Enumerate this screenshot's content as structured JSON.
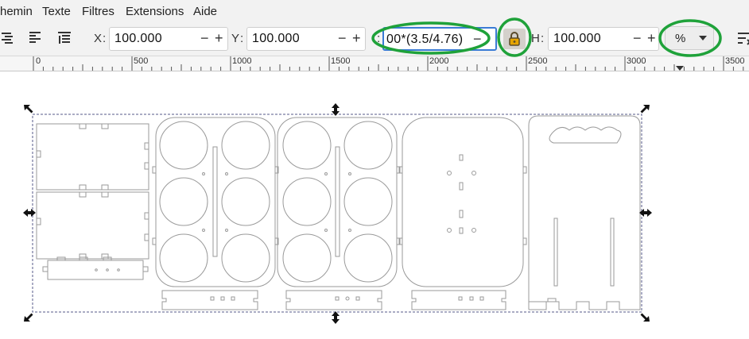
{
  "menu": {
    "items": [
      "hemin",
      "Texte",
      "Filtres",
      "Extensions",
      "Aide"
    ]
  },
  "toolbar": {
    "x_label": "X",
    "x_value": "100.000",
    "y_label": "Y",
    "y_value": "100.000",
    "w_value": "00*(3.5/4.76)",
    "h_label": "H",
    "h_value": "100.000",
    "unit": "%",
    "minus": "−",
    "plus": "+"
  },
  "ruler": {
    "labels": [
      "0",
      "500",
      "1000",
      "1500",
      "2000",
      "2500",
      "3000",
      "3500"
    ]
  },
  "colors": {
    "annotation": "#1fa23a",
    "focus": "#3a7bd5",
    "selection": "#555a8a",
    "lock": "#e6a400"
  }
}
